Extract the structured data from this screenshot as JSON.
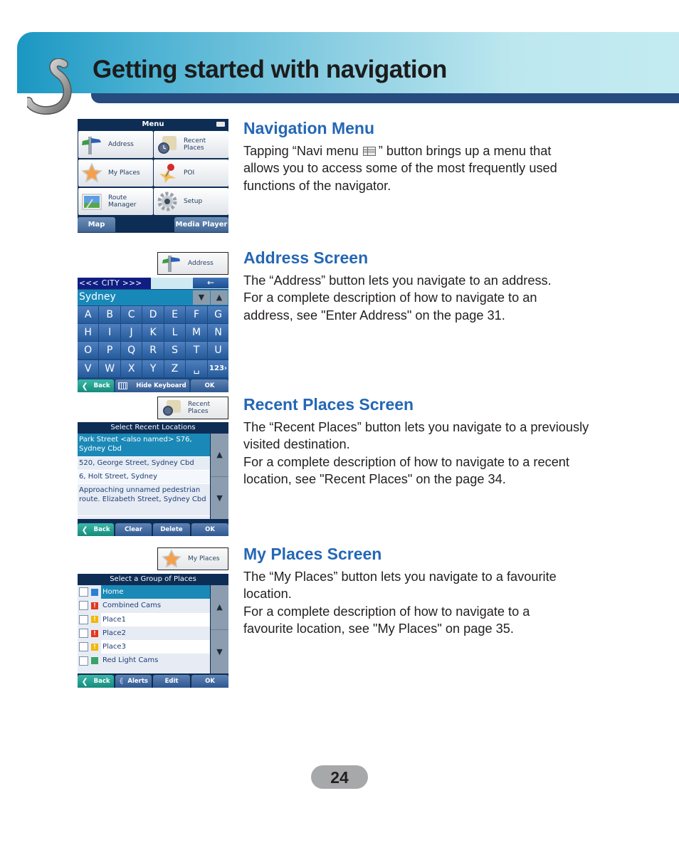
{
  "header": {
    "title": "Getting started with navigation"
  },
  "sections": [
    {
      "title": "Navigation Menu",
      "body_parts": [
        "Tapping “Navi menu",
        "” button brings up a menu that allows you to access some of the most frequently used functions of the navigator."
      ],
      "inline_icon": "navi-menu-icon"
    },
    {
      "title": "Address Screen",
      "body_lines": [
        "The “Address” button lets you navigate to an address.",
        "For a complete description of how to navigate to an address, see \"Enter Address\" on the page 31."
      ]
    },
    {
      "title": "Recent Places Screen",
      "body_lines": [
        "The “Recent Places” button lets you navigate to a previously visited destination.",
        "For a complete description of how to navigate to a recent location, see \"Recent Places\" on the page 34."
      ]
    },
    {
      "title": "My Places Screen",
      "body_lines": [
        "The “My Places” button lets you navigate to a favourite location.",
        "For a complete description of how to navigate to a favourite location, see \"My Places\" on page 35."
      ]
    }
  ],
  "menu_screen": {
    "title": "Menu",
    "status_icon": "battery-icon",
    "tiles": [
      {
        "label_1": "Address",
        "label_2": "",
        "icon": "signpost-icon"
      },
      {
        "label_1": "Recent",
        "label_2": "Places",
        "icon": "scroll-clock-icon"
      },
      {
        "label_1": "My Places",
        "label_2": "",
        "icon": "star-icon"
      },
      {
        "label_1": "POI",
        "label_2": "",
        "icon": "pushpin-star-icon"
      },
      {
        "label_1": "Route",
        "label_2": "Manager",
        "icon": "route-picture-icon"
      },
      {
        "label_1": "Setup",
        "label_2": "",
        "icon": "gear-icon"
      }
    ],
    "bottom_left": "Map",
    "bottom_right": "Media Player"
  },
  "address_screen": {
    "button_label": "Address",
    "city_field": "<<<  CITY  >>>",
    "input_value": "Sydney",
    "keys": [
      "A",
      "B",
      "C",
      "D",
      "E",
      "F",
      "G",
      "H",
      "I",
      "J",
      "K",
      "L",
      "M",
      "N",
      "O",
      "P",
      "Q",
      "R",
      "S",
      "T",
      "U",
      "V",
      "W",
      "X",
      "Y",
      "Z",
      "␣",
      "123›"
    ],
    "bottom": {
      "back": "Back",
      "hide": "Hide Keyboard",
      "ok": "OK"
    }
  },
  "recent_screen": {
    "button_label_1": "Recent",
    "button_label_2": "Places",
    "title": "Select Recent Locations",
    "items": [
      "Park Street <also named> S76, Sydney Cbd",
      "520, George Street, Sydney Cbd",
      "6, Holt Street, Sydney",
      "Approaching unnamed pedestrian route. Elizabeth Street, Sydney Cbd"
    ],
    "bottom": {
      "back": "Back",
      "clear": "Clear",
      "delete": "Delete",
      "ok": "OK"
    }
  },
  "myplaces_screen": {
    "button_label": "My Places",
    "title": "Select a Group of Places",
    "items": [
      {
        "label": "Home",
        "icon": "home-icon",
        "color": "#2a7fd4"
      },
      {
        "label": "Combined Cams",
        "icon": "alert-red-icon",
        "color": "#e2361f"
      },
      {
        "label": "Place1",
        "icon": "alert-yellow-icon",
        "color": "#f2b705"
      },
      {
        "label": "Place2",
        "icon": "alert-red-icon",
        "color": "#e2361f"
      },
      {
        "label": "Place3",
        "icon": "alert-yellow-icon",
        "color": "#f2b705"
      },
      {
        "label": "Red Light Cams",
        "icon": "traffic-light-icon",
        "color": "#3aa36a"
      }
    ],
    "bottom": {
      "back": "Back",
      "alerts": "Alerts",
      "edit": "Edit",
      "ok": "OK"
    }
  },
  "page_number": "24",
  "colors": {
    "heading_blue": "#2467b5",
    "header_dark": "#264b7e",
    "device_navy": "#0e2d55"
  }
}
